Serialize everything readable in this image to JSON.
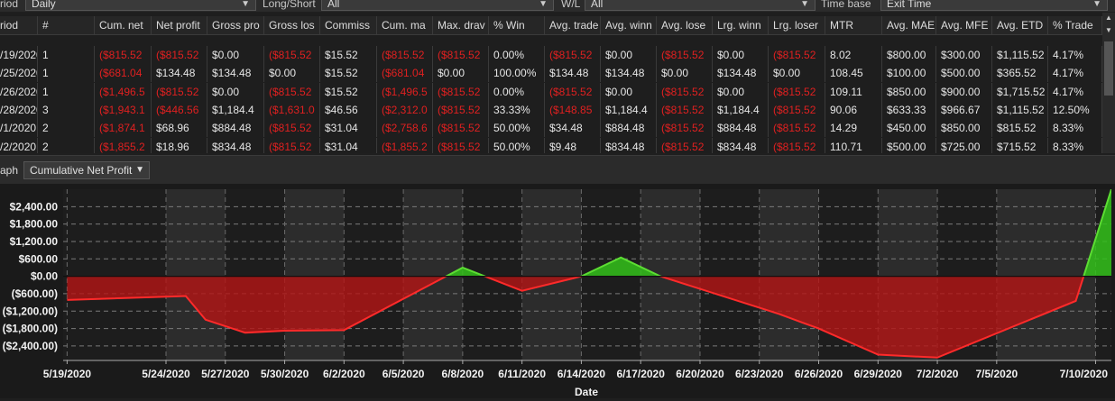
{
  "filters": [
    {
      "label": "riod",
      "value": "Daily",
      "label_left": 0,
      "sel_left": 28,
      "sel_w": 256
    },
    {
      "label": "Long/Short",
      "value": "All",
      "label_left": 291,
      "sel_left": 356,
      "sel_w": 258
    },
    {
      "label": "W/L",
      "value": "All",
      "label_left": 622,
      "sel_left": 648,
      "sel_w": 256
    },
    {
      "label": "Time base",
      "value": "Exit Time",
      "label_left": 910,
      "sel_left": 976,
      "sel_w": 252
    }
  ],
  "table": {
    "columns": [
      "riod",
      "#",
      "Cum. net",
      "Net profit",
      "Gross pro",
      "Gross los",
      "Commiss",
      "Cum. ma",
      "Max. drav",
      "% Win",
      "Avg. trade",
      "Avg. winn",
      "Avg. lose",
      "Lrg. winn",
      "Lrg. loser",
      "MTR",
      "Avg. MAE",
      "Avg. MFE",
      "Avg. ETD",
      "% Trade"
    ],
    "rows": [
      [
        "/19/2020",
        "1",
        "($815.52",
        "($815.52",
        "$0.00",
        "($815.52",
        "$15.52",
        "($815.52",
        "($815.52",
        "0.00%",
        "($815.52",
        "$0.00",
        "($815.52",
        "$0.00",
        "($815.52",
        "8.02",
        "$800.00",
        "$300.00",
        "$1,115.52",
        "4.17%"
      ],
      [
        "/25/2020",
        "1",
        "($681.04",
        "$134.48",
        "$134.48",
        "$0.00",
        "$15.52",
        "($681.04",
        "$0.00",
        "100.00%",
        "$134.48",
        "$134.48",
        "$0.00",
        "$134.48",
        "$0.00",
        "108.45",
        "$100.00",
        "$500.00",
        "$365.52",
        "4.17%"
      ],
      [
        "/26/2020",
        "1",
        "($1,496.5",
        "($815.52",
        "$0.00",
        "($815.52",
        "$15.52",
        "($1,496.5",
        "($815.52",
        "0.00%",
        "($815.52",
        "$0.00",
        "($815.52",
        "$0.00",
        "($815.52",
        "109.11",
        "$850.00",
        "$900.00",
        "$1,715.52",
        "4.17%"
      ],
      [
        "/28/2020",
        "3",
        "($1,943.1",
        "($446.56",
        "$1,184.4",
        "($1,631.0",
        "$46.56",
        "($2,312.0",
        "($815.52",
        "33.33%",
        "($148.85",
        "$1,184.4",
        "($815.52",
        "$1,184.4",
        "($815.52",
        "90.06",
        "$633.33",
        "$966.67",
        "$1,115.52",
        "12.50%"
      ],
      [
        "/1/2020",
        "2",
        "($1,874.1",
        "$68.96",
        "$884.48",
        "($815.52",
        "$31.04",
        "($2,758.6",
        "($815.52",
        "50.00%",
        "$34.48",
        "$884.48",
        "($815.52",
        "$884.48",
        "($815.52",
        "14.29",
        "$450.00",
        "$850.00",
        "$815.52",
        "8.33%"
      ],
      [
        "/2/2020",
        "2",
        "($1,855.2",
        "$18.96",
        "$834.48",
        "($815.52",
        "$31.04",
        "($1,855.2",
        "($815.52",
        "50.00%",
        "$9.48",
        "$834.48",
        "($815.52",
        "$834.48",
        "($815.52",
        "110.71",
        "$500.00",
        "$725.00",
        "$715.52",
        "8.33%"
      ]
    ]
  },
  "graph": {
    "label": "aph",
    "selected": "Cumulative Net Profit"
  },
  "chart_data": {
    "type": "area",
    "title": "",
    "xlabel": "Date",
    "ylabel": "",
    "y_ticks": [
      "$2,400.00",
      "$1,800.00",
      "$1,200.00",
      "$600.00",
      "$0.00",
      "($600.00)",
      "($1,200.00)",
      "($1,800.00)",
      "($2,400.00)"
    ],
    "y_tick_values": [
      2400,
      1800,
      1200,
      600,
      0,
      -600,
      -1200,
      -1800,
      -2400
    ],
    "ylim": [
      -2900,
      3000
    ],
    "x_ticks": [
      "5/19/2020",
      "5/24/2020",
      "5/27/2020",
      "5/30/2020",
      "6/2/2020",
      "6/5/2020",
      "6/8/2020",
      "6/11/2020",
      "6/14/2020",
      "6/17/2020",
      "6/20/2020",
      "6/23/2020",
      "6/26/2020",
      "6/29/2020",
      "7/2/2020",
      "7/5/2020",
      "7/10/2020"
    ],
    "x_tick_positions": [
      0,
      5,
      8,
      11,
      14,
      17,
      20,
      23,
      26,
      29,
      32,
      35,
      38,
      41,
      44,
      47,
      52
    ],
    "xlim": [
      -0.2,
      52.8
    ],
    "points": [
      [
        0,
        -815.52
      ],
      [
        6,
        -681.04
      ],
      [
        7,
        -1496.56
      ],
      [
        9,
        -1943.12
      ],
      [
        11,
        -1874.16
      ],
      [
        14,
        -1855.2
      ],
      [
        20,
        300
      ],
      [
        23,
        -500
      ],
      [
        26,
        0
      ],
      [
        28,
        650
      ],
      [
        30,
        0
      ],
      [
        36,
        -1300
      ],
      [
        38,
        -1800
      ],
      [
        41,
        -2700
      ],
      [
        44,
        -2800
      ],
      [
        51,
        -850
      ],
      [
        52.8,
        3000
      ]
    ],
    "pos_color": "#33c11a",
    "neg_color": "#b51515",
    "line_color": "#ff2a2a",
    "grid": true
  }
}
